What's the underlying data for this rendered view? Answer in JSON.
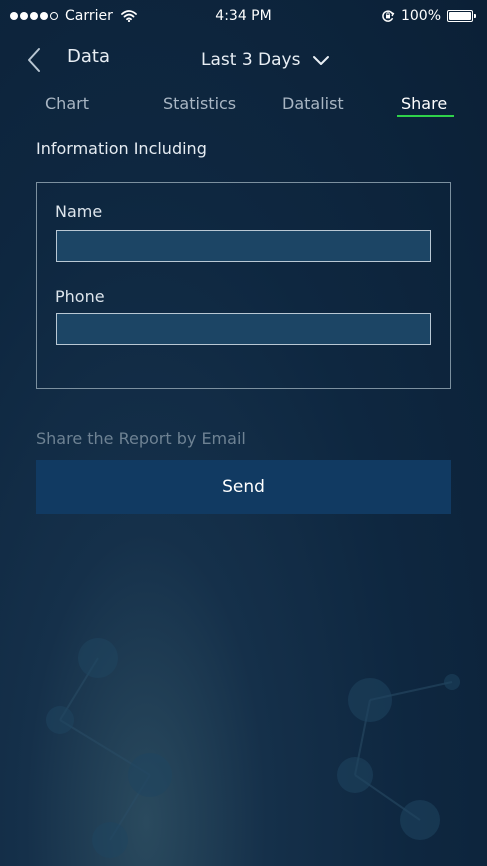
{
  "status_bar": {
    "signal_dots": [
      true,
      true,
      true,
      true,
      false
    ],
    "carrier": "Carrier",
    "time": "4:34 PM",
    "battery_percent": "100%",
    "battery_level": 1.0
  },
  "nav": {
    "back_label": "Data",
    "range_label": "Last 3 Days",
    "back_icon": "chevron-left-icon",
    "dropdown_icon": "chevron-down-icon"
  },
  "tabs": [
    {
      "label": "Chart",
      "active": false
    },
    {
      "label": "Statistics",
      "active": false
    },
    {
      "label": "Datalist",
      "active": false
    },
    {
      "label": "Share",
      "active": true
    }
  ],
  "share": {
    "section_label": "Information Including",
    "fields": {
      "name": {
        "label": "Name",
        "value": "",
        "placeholder": ""
      },
      "phone": {
        "label": "Phone",
        "value": "",
        "placeholder": ""
      }
    },
    "email_label": "Share the Report by Email",
    "send_label": "Send"
  },
  "colors": {
    "accent_underline": "#2fd24a",
    "button_bg": "#113a62",
    "input_bg": "#1c4565",
    "background": "#0e2740"
  }
}
